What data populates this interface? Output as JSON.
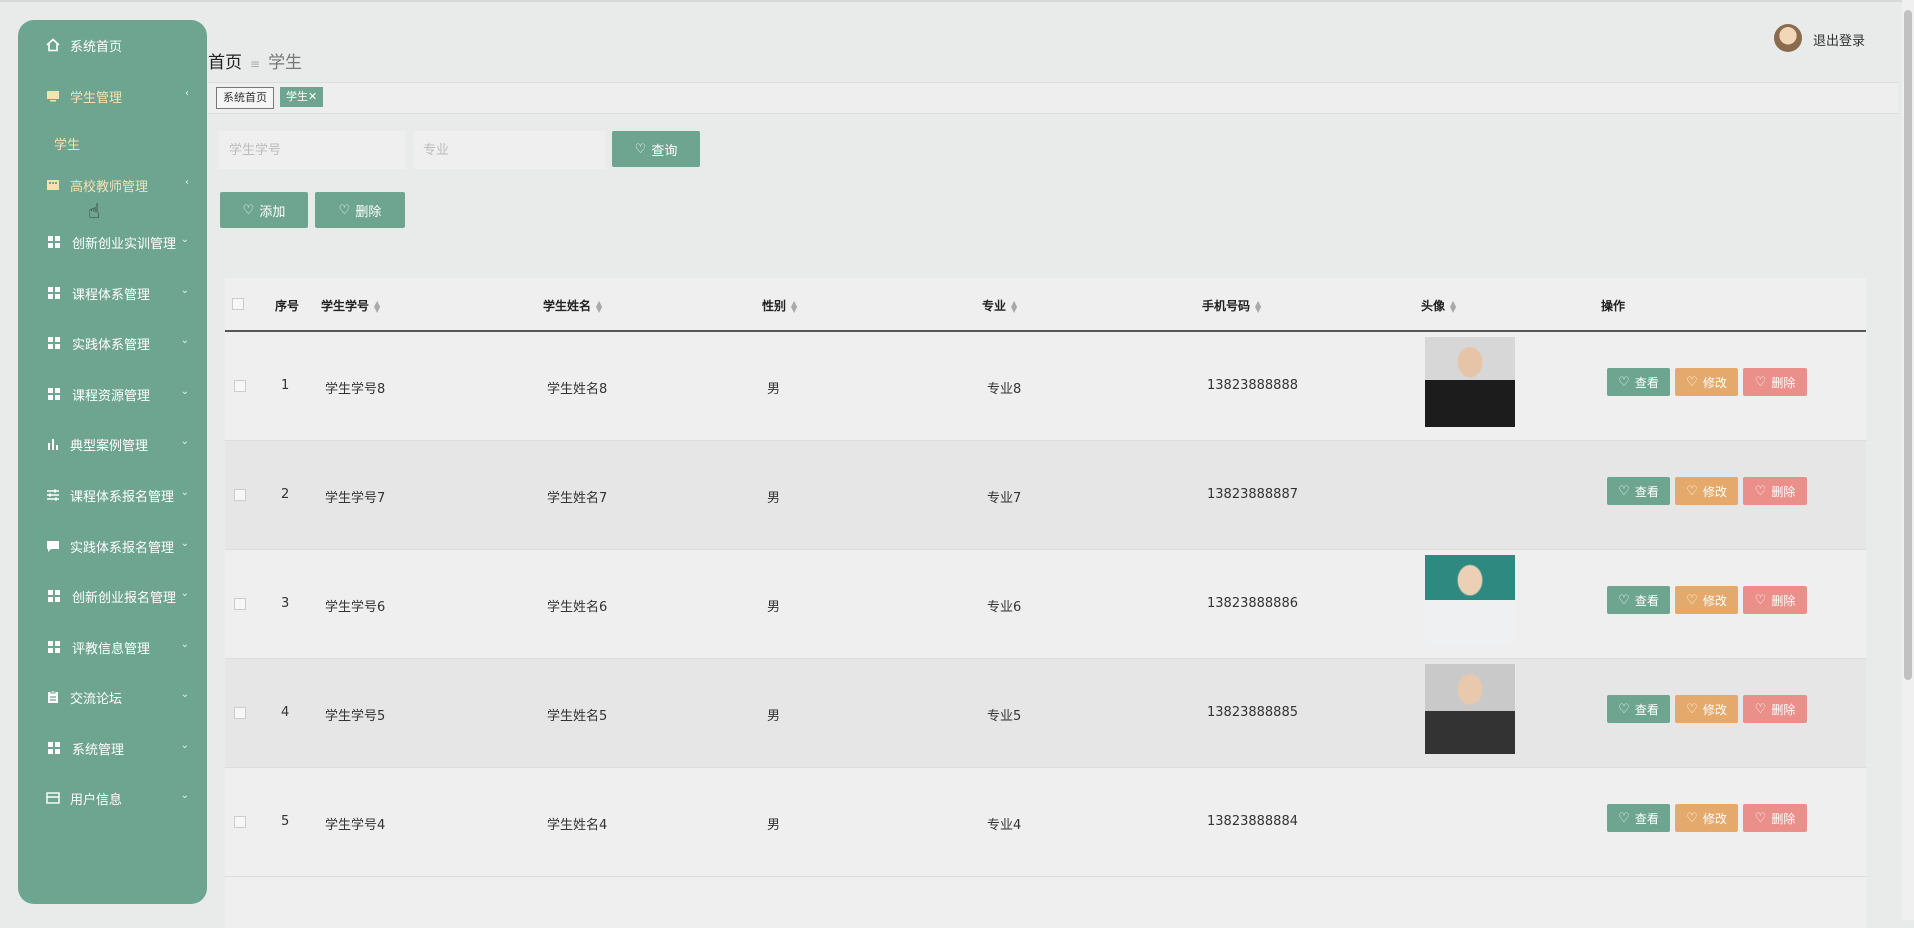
{
  "sidebar": {
    "items": [
      {
        "label": "系统首页",
        "icon": "home-icon",
        "arrow": ""
      },
      {
        "label": "学生管理",
        "icon": "monitor-icon",
        "arrow": "‹"
      },
      {
        "label": "高校教师管理",
        "icon": "building-icon",
        "arrow": "‹"
      },
      {
        "label": "创新创业实训管理",
        "icon": "grid-icon",
        "arrow": "⌄"
      },
      {
        "label": "课程体系管理",
        "icon": "grid-icon",
        "arrow": "⌄"
      },
      {
        "label": "实践体系管理",
        "icon": "grid-icon",
        "arrow": "⌄"
      },
      {
        "label": "课程资源管理",
        "icon": "grid-icon",
        "arrow": "⌄"
      },
      {
        "label": "典型案例管理",
        "icon": "bar-chart-icon",
        "arrow": "⌄"
      },
      {
        "label": "课程体系报名管理",
        "icon": "sliders-icon",
        "arrow": "⌄"
      },
      {
        "label": "实践体系报名管理",
        "icon": "chat-icon",
        "arrow": "⌄"
      },
      {
        "label": "创新创业报名管理",
        "icon": "grid-icon",
        "arrow": "⌄"
      },
      {
        "label": "评教信息管理",
        "icon": "grid-icon",
        "arrow": "⌄"
      },
      {
        "label": "交流论坛",
        "icon": "clipboard-icon",
        "arrow": "⌄"
      },
      {
        "label": "系统管理",
        "icon": "grid-icon",
        "arrow": "⌄"
      },
      {
        "label": "用户信息",
        "icon": "card-icon",
        "arrow": "⌄"
      }
    ],
    "sub_item": "学生"
  },
  "header": {
    "breadcrumb_home": "首页",
    "breadcrumb_sep": "≡",
    "breadcrumb_current": "学生",
    "logout": "退出登录"
  },
  "tabs": {
    "home": "系统首页",
    "current": "学生✕"
  },
  "search": {
    "id_placeholder": "学生学号",
    "major_placeholder": "专业",
    "query_label": "查询"
  },
  "toolbar": {
    "add_label": "添加",
    "delete_label": "删除"
  },
  "table": {
    "headers": [
      "序号",
      "学生学号",
      "学生姓名",
      "性别",
      "专业",
      "手机号码",
      "头像",
      "操作"
    ],
    "rows": [
      {
        "no": "1",
        "id": "学生学号8",
        "name": "学生姓名8",
        "gender": "男",
        "major": "专业8",
        "phone": "13823888888",
        "photo": "dark"
      },
      {
        "no": "2",
        "id": "学生学号7",
        "name": "学生姓名7",
        "gender": "男",
        "major": "专业7",
        "phone": "13823888887",
        "photo": ""
      },
      {
        "no": "3",
        "id": "学生学号6",
        "name": "学生姓名6",
        "gender": "男",
        "major": "专业6",
        "phone": "13823888886",
        "photo": "teal"
      },
      {
        "no": "4",
        "id": "学生学号5",
        "name": "学生姓名5",
        "gender": "男",
        "major": "专业5",
        "phone": "13823888885",
        "photo": "grey"
      },
      {
        "no": "5",
        "id": "学生学号4",
        "name": "学生姓名4",
        "gender": "男",
        "major": "专业4",
        "phone": "13823888884",
        "photo": ""
      }
    ],
    "actions": {
      "view": "查看",
      "edit": "修改",
      "delete": "删除"
    }
  },
  "colors": {
    "accent": "#6da591",
    "edit": "#e5a96c",
    "delete": "#eb8f8a",
    "active_menu_text": "#f7e1b0"
  }
}
